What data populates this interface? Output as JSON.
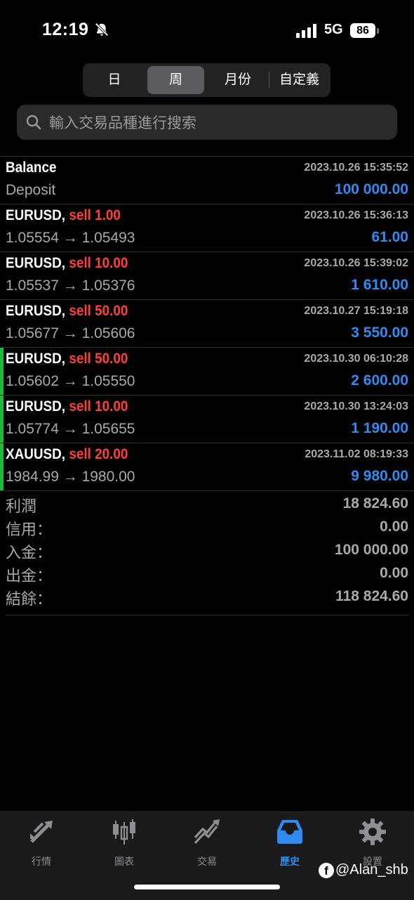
{
  "status_bar": {
    "time": "12:19",
    "network": "5G",
    "battery": "86"
  },
  "segments": [
    {
      "label": "日",
      "active": false
    },
    {
      "label": "周",
      "active": true
    },
    {
      "label": "月份",
      "active": false
    },
    {
      "label": "自定義",
      "active": false
    }
  ],
  "search": {
    "placeholder": "輸入交易品種進行搜索",
    "value": ""
  },
  "rows": [
    {
      "title": "Balance",
      "type": "",
      "volume": "",
      "date": "2023.10.26 15:35:52",
      "desc": "Deposit",
      "profit": "100 000.00"
    },
    {
      "title": "EURUSD,",
      "type": "sell",
      "volume": "1.00",
      "date": "2023.10.26 15:36:13",
      "desc": "1.05554 → 1.05493",
      "profit": "61.00"
    },
    {
      "title": "EURUSD,",
      "type": "sell",
      "volume": "10.00",
      "date": "2023.10.26 15:39:02",
      "desc": "1.05537 → 1.05376",
      "profit": "1 610.00"
    },
    {
      "title": "EURUSD,",
      "type": "sell",
      "volume": "50.00",
      "date": "2023.10.27 15:19:18",
      "desc": "1.05677 → 1.05606",
      "profit": "3 550.00"
    },
    {
      "title": "EURUSD,",
      "type": "sell",
      "volume": "50.00",
      "date": "2023.10.30 06:10:28",
      "desc": "1.05602 → 1.05550",
      "profit": "2 600.00"
    },
    {
      "title": "EURUSD,",
      "type": "sell",
      "volume": "10.00",
      "date": "2023.10.30 13:24:03",
      "desc": "1.05774 → 1.05655",
      "profit": "1 190.00"
    },
    {
      "title": "XAUUSD,",
      "type": "sell",
      "volume": "20.00",
      "date": "2023.11.02 08:19:33",
      "desc": "1984.99 → 1980.00",
      "profit": "9 980.00"
    }
  ],
  "summary": [
    {
      "label": "利潤",
      "value": "18 824.60"
    },
    {
      "label": "信用：",
      "value": "0.00"
    },
    {
      "label": "入金：",
      "value": "100 000.00"
    },
    {
      "label": "出金：",
      "value": "0.00"
    },
    {
      "label": "結餘：",
      "value": "118 824.60"
    }
  ],
  "tabs": [
    {
      "label": "行情",
      "icon": "quotes-arrows-icon",
      "active": false
    },
    {
      "label": "圖表",
      "icon": "candlestick-chart-icon",
      "active": false
    },
    {
      "label": "交易",
      "icon": "trade-trend-icon",
      "active": false
    },
    {
      "label": "歷史",
      "icon": "history-inbox-icon",
      "active": true
    },
    {
      "label": "設置",
      "icon": "gear-icon",
      "active": false
    }
  ],
  "watermark": "@Alan_shb",
  "colors": {
    "accent": "#2f8bf0",
    "sell": "#ff4036",
    "row_marker": "#1fb83a",
    "background": "#000000"
  }
}
